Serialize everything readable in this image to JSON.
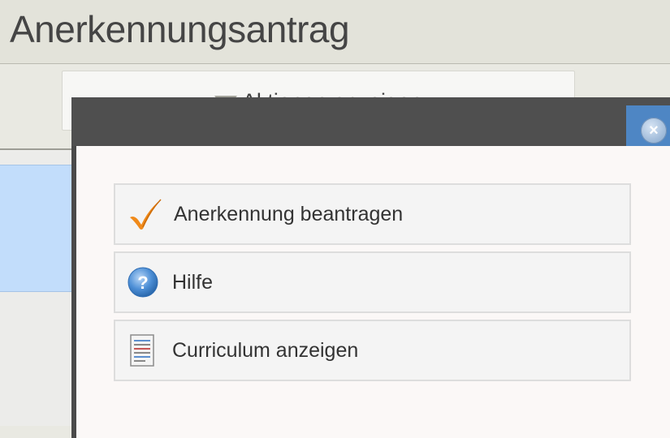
{
  "page": {
    "title": "Anerkennungsantrag"
  },
  "toolbar": {
    "actions_label": "Aktionen anzeigen"
  },
  "dialog": {
    "close_icon": "close-icon",
    "items": [
      {
        "label": "Anerkennung beantragen",
        "icon": "checkmark-icon"
      },
      {
        "label": "Hilfe",
        "icon": "help-icon"
      },
      {
        "label": "Curriculum anzeigen",
        "icon": "document-icon"
      }
    ]
  },
  "colors": {
    "dialog_titlebar": "#4f4f4f",
    "close_button": "#4e86c4",
    "checkmark": "#f08a1a",
    "selected_row": "#c2ddfb"
  }
}
